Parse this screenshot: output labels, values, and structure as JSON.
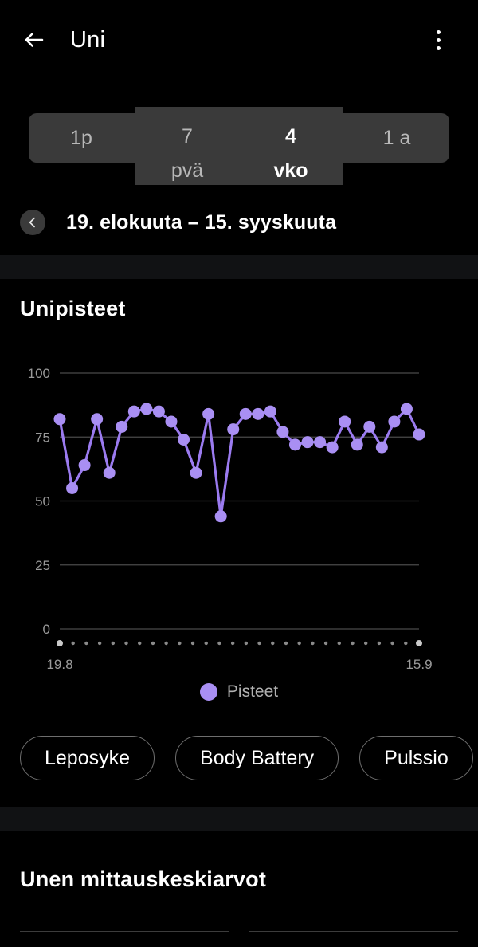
{
  "appbar": {
    "back_icon": "arrow-left-icon",
    "title": "Uni",
    "overflow_icon": "more-vertical-icon"
  },
  "range_tabs": {
    "items": [
      {
        "label": "1p",
        "active": false
      },
      {
        "line1": "7",
        "line2": "pvä",
        "active": false
      },
      {
        "line1": "4",
        "line2": "vko",
        "active": true
      },
      {
        "label": "1 a",
        "active": false
      }
    ]
  },
  "date_nav": {
    "prev_icon": "chevron-left-icon",
    "range": "19. elokuuta – 15. syyskuuta"
  },
  "sleep_score_card": {
    "title": "Unipisteet",
    "legend": {
      "label": "Pisteet",
      "color": "#A98FF3"
    }
  },
  "metric_pills": [
    {
      "label": "Leposyke"
    },
    {
      "label": "Body Battery"
    },
    {
      "label": "Pulssio"
    }
  ],
  "averages_card": {
    "title": "Unen mittauskeskiarvot"
  },
  "chart_data": {
    "type": "line",
    "title": "Unipisteet",
    "xlabel": "",
    "ylabel": "",
    "ylim": [
      0,
      100
    ],
    "yticks": [
      0,
      25,
      50,
      75,
      100
    ],
    "grid": true,
    "legend_position": "bottom",
    "x_axis_start_label": "19.8",
    "x_axis_end_label": "15.9",
    "point_color": "#A98FF3",
    "line_color": "#9B7BF0",
    "n_points": 28,
    "series": [
      {
        "name": "Pisteet",
        "values": [
          82,
          55,
          64,
          82,
          61,
          79,
          85,
          86,
          85,
          81,
          74,
          61,
          84,
          44,
          78,
          84,
          84,
          85,
          77,
          72,
          73,
          73,
          71,
          81,
          72,
          79,
          71,
          81,
          86,
          76
        ]
      }
    ]
  }
}
